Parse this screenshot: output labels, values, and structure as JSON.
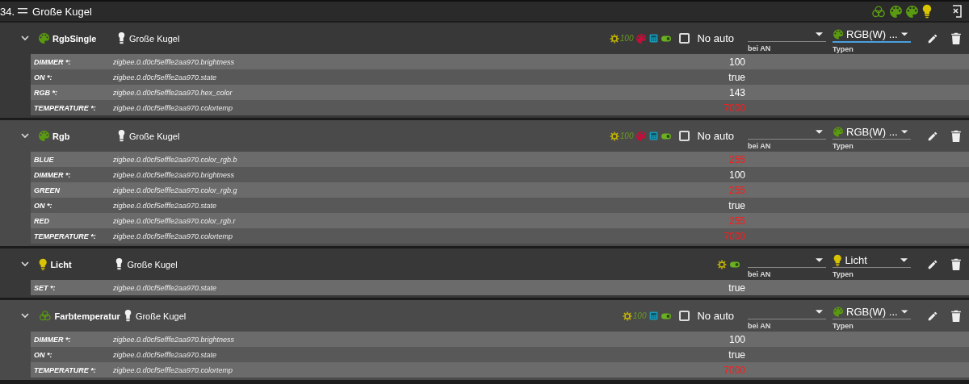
{
  "header": {
    "index": "34.",
    "title": "Große Kugel",
    "icons": [
      {
        "kind": "rings"
      },
      {
        "kind": "palette"
      },
      {
        "kind": "palette"
      },
      {
        "kind": "bulb"
      }
    ]
  },
  "sections": [
    {
      "name": "RgbSingle",
      "kind": "rgb",
      "device": "Große Kugel",
      "indicators": [
        {
          "kind": "dimmer",
          "text": "100"
        },
        {
          "kind": "palette"
        },
        {
          "kind": "calc"
        },
        {
          "kind": "toggle"
        }
      ],
      "no_auto": {
        "label": "No auto",
        "checked": false
      },
      "on_select": {
        "label": "bei AN"
      },
      "type_select": {
        "kind": "rgb",
        "value": "RGB(W) ...",
        "label": "Typen",
        "focused": true
      },
      "states": [
        {
          "label": "DIMMER *:",
          "id": "zigbee.0.d0cf5efffe2aa970.brightness",
          "value": "100",
          "alert": false
        },
        {
          "label": "ON *:",
          "id": "zigbee.0.d0cf5efffe2aa970.state",
          "value": "true",
          "alert": false
        },
        {
          "label": "RGB *:",
          "id": "zigbee.0.d0cf5efffe2aa970.hex_color",
          "value": "143",
          "alert": false
        },
        {
          "label": "TEMPERATURE *:",
          "id": "zigbee.0.d0cf5efffe2aa970.colortemp",
          "value": "7000",
          "alert": true
        }
      ]
    },
    {
      "name": "Rgb",
      "kind": "rgb",
      "device": "Große Kugel",
      "indicators": [
        {
          "kind": "dimmer",
          "text": "100"
        },
        {
          "kind": "palette"
        },
        {
          "kind": "calc"
        },
        {
          "kind": "toggle"
        }
      ],
      "no_auto": {
        "label": "No auto",
        "checked": false
      },
      "on_select": {
        "label": "bei AN"
      },
      "type_select": {
        "kind": "rgb",
        "value": "RGB(W) ...",
        "label": "Typen",
        "focused": false
      },
      "states": [
        {
          "label": "BLUE",
          "id": "zigbee.0.d0cf5efffe2aa970.color_rgb.b",
          "value": "255",
          "alert": true
        },
        {
          "label": "DIMMER *:",
          "id": "zigbee.0.d0cf5efffe2aa970.brightness",
          "value": "100",
          "alert": false
        },
        {
          "label": "GREEN",
          "id": "zigbee.0.d0cf5efffe2aa970.color_rgb.g",
          "value": "255",
          "alert": true
        },
        {
          "label": "ON *:",
          "id": "zigbee.0.d0cf5efffe2aa970.state",
          "value": "true",
          "alert": false
        },
        {
          "label": "RED",
          "id": "zigbee.0.d0cf5efffe2aa970.color_rgb.r",
          "value": "255",
          "alert": true
        },
        {
          "label": "TEMPERATURE *:",
          "id": "zigbee.0.d0cf5efffe2aa970.colortemp",
          "value": "7000",
          "alert": true
        }
      ]
    },
    {
      "name": "Licht",
      "kind": "light",
      "device": "Große Kugel",
      "indicators": [
        {
          "kind": "dimmer"
        },
        {
          "kind": "toggle"
        }
      ],
      "on_select": {
        "label": "bei AN"
      },
      "type_select": {
        "kind": "light",
        "value": "Licht",
        "label": "Typen",
        "focused": false
      },
      "states": [
        {
          "label": "SET *:",
          "id": "zigbee.0.d0cf5efffe2aa970.state",
          "value": "true",
          "alert": false
        }
      ]
    },
    {
      "name": "Farbtemperatur",
      "kind": "ct",
      "device": "Große Kugel",
      "indicators": [
        {
          "kind": "dimmer",
          "text": "100"
        },
        {
          "kind": "calc"
        },
        {
          "kind": "toggle"
        }
      ],
      "no_auto": {
        "label": "No auto",
        "checked": false
      },
      "on_select": {
        "label": "bei AN"
      },
      "type_select": {
        "kind": "rgb",
        "value": "RGB(W) ...",
        "label": "Typen",
        "focused": false
      },
      "states": [
        {
          "label": "DIMMER *:",
          "id": "zigbee.0.d0cf5efffe2aa970.brightness",
          "value": "100",
          "alert": false
        },
        {
          "label": "ON *:",
          "id": "zigbee.0.d0cf5efffe2aa970.state",
          "value": "true",
          "alert": false
        },
        {
          "label": "TEMPERATURE *:",
          "id": "zigbee.0.d0cf5efffe2aa970.colortemp",
          "value": "7000",
          "alert": true
        }
      ]
    }
  ]
}
